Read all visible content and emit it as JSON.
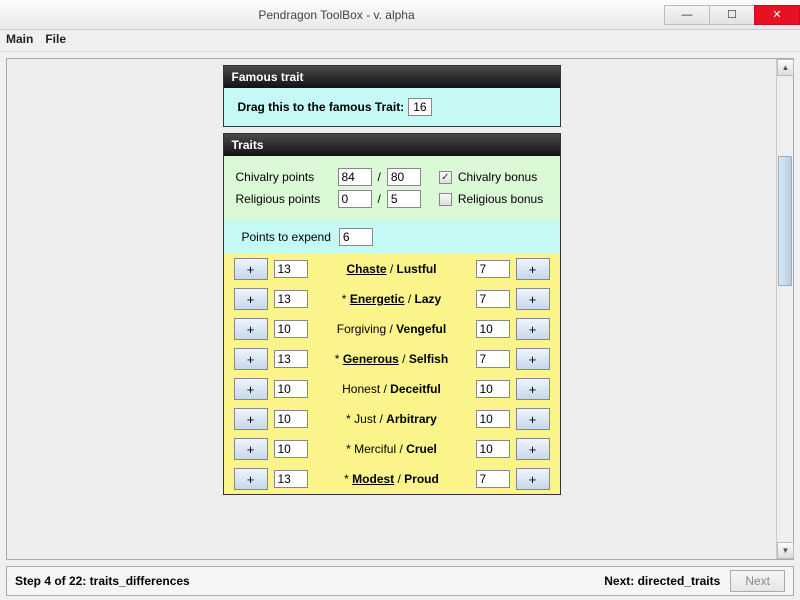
{
  "window": {
    "title": "Pendragon ToolBox - v. alpha"
  },
  "menu": {
    "main": "Main",
    "file": "File"
  },
  "famous": {
    "header": "Famous trait",
    "label": "Drag this to the famous Trait:",
    "value": "16"
  },
  "traits": {
    "header": "Traits",
    "chivalry": {
      "label": "Chivalry points",
      "value": "84",
      "max": "80",
      "bonus_label": "Chivalry bonus",
      "bonus_checked": true
    },
    "religious": {
      "label": "Religious points",
      "value": "0",
      "max": "5",
      "bonus_label": "Religious bonus",
      "bonus_checked": false
    },
    "expend": {
      "label": "Points to expend",
      "value": "6"
    },
    "slash": "/",
    "plus": "+",
    "rows": [
      {
        "left": "Chaste",
        "right": "Lustful",
        "lv": "13",
        "rv": "7",
        "star": false,
        "ul": true
      },
      {
        "left": "Energetic",
        "right": "Lazy",
        "lv": "13",
        "rv": "7",
        "star": true,
        "ul": true
      },
      {
        "left": "Forgiving",
        "right": "Vengeful",
        "lv": "10",
        "rv": "10",
        "star": false,
        "ul": false
      },
      {
        "left": "Generous",
        "right": "Selfish",
        "lv": "13",
        "rv": "7",
        "star": true,
        "ul": true
      },
      {
        "left": "Honest",
        "right": "Deceitful",
        "lv": "10",
        "rv": "10",
        "star": false,
        "ul": false
      },
      {
        "left": "Just",
        "right": "Arbitrary",
        "lv": "10",
        "rv": "10",
        "star": true,
        "ul": false
      },
      {
        "left": "Merciful",
        "right": "Cruel",
        "lv": "10",
        "rv": "10",
        "star": true,
        "ul": false
      },
      {
        "left": "Modest",
        "right": "Proud",
        "lv": "13",
        "rv": "7",
        "star": true,
        "ul": true
      }
    ]
  },
  "footer": {
    "step": "Step 4 of 22: traits_differences",
    "next_label": "Next: directed_traits",
    "next_button": "Next"
  }
}
